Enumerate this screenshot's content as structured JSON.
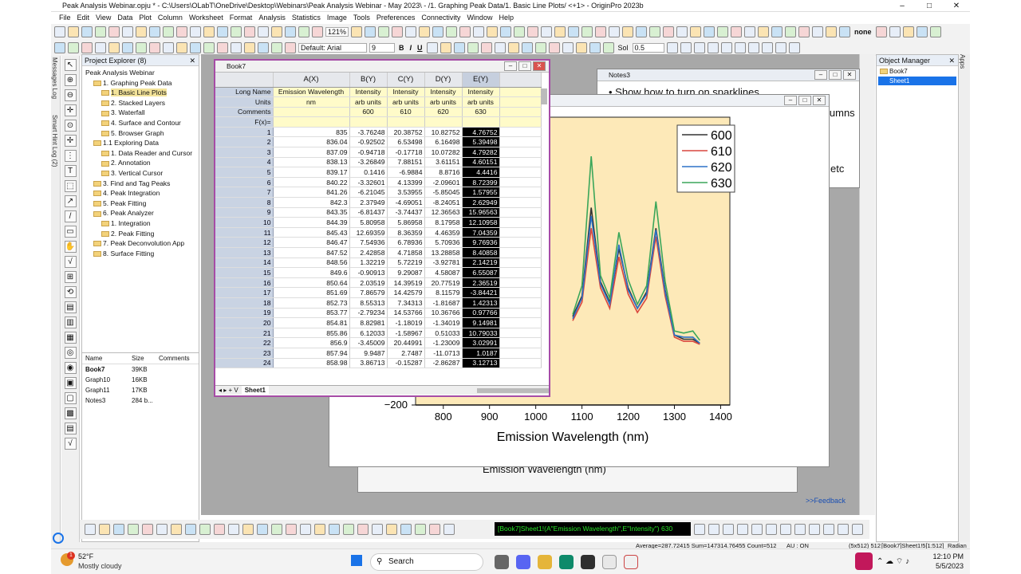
{
  "window": {
    "title": "Peak Analysis Webinar.opju * - C:\\Users\\OLabT\\OneDrive\\Desktop\\Webinars\\Peak Analysis Webinar - May 2023\\ - /1. Graphing Peak Data/1. Basic Line Plots/ <+1> - OriginPro 2023b",
    "min": "–",
    "max": "□",
    "close": "✕"
  },
  "menu": [
    "File",
    "Edit",
    "View",
    "Data",
    "Plot",
    "Column",
    "Worksheet",
    "Format",
    "Analysis",
    "Statistics",
    "Image",
    "Tools",
    "Preferences",
    "Connectivity",
    "Window",
    "Help"
  ],
  "toolbar": {
    "zoom": "121%",
    "font": "Default: Arial",
    "font_size": "9",
    "bold": "B",
    "italic": "I",
    "underline": "U",
    "line_style": "Sol",
    "line_width": "0.5",
    "none": "none"
  },
  "side_tabs": {
    "messages": "Messages Log",
    "smart_hint": "Smart Hint Log (2)"
  },
  "project_explorer": {
    "title": "Project Explorer (8)",
    "tree": [
      {
        "label": "Peak Analysis Webinar",
        "level": 0
      },
      {
        "label": "1. Graphing Peak Data",
        "level": 1
      },
      {
        "label": "1. Basic Line Plots",
        "level": 2,
        "selected": true
      },
      {
        "label": "2. Stacked Layers",
        "level": 2
      },
      {
        "label": "3. Waterfall",
        "level": 2
      },
      {
        "label": "4. Surface and Contour",
        "level": 2
      },
      {
        "label": "5. Browser Graph",
        "level": 2
      },
      {
        "label": "1.1 Exploring Data",
        "level": 1
      },
      {
        "label": "1. Data Reader and Cursor",
        "level": 2
      },
      {
        "label": "2. Annotation",
        "level": 2
      },
      {
        "label": "3. Vertical Cursor",
        "level": 2
      },
      {
        "label": "3. Find and Tag Peaks",
        "level": 1
      },
      {
        "label": "4. Peak Integration",
        "level": 1
      },
      {
        "label": "5. Peak Fitting",
        "level": 1
      },
      {
        "label": "6. Peak Analyzer",
        "level": 1
      },
      {
        "label": "1. Integration",
        "level": 2
      },
      {
        "label": "2. Peak Fitting",
        "level": 2
      },
      {
        "label": "7. Peak Deconvolution App",
        "level": 1
      },
      {
        "label": "8. Surface Fitting",
        "level": 1
      }
    ],
    "files_headers": [
      "Name",
      "Size",
      "Comments"
    ],
    "files": [
      {
        "name": "Book7",
        "size": "39KB"
      },
      {
        "name": "Graph10",
        "size": "16KB"
      },
      {
        "name": "Graph11",
        "size": "17KB"
      },
      {
        "name": "Notes3",
        "size": "284 b..."
      }
    ]
  },
  "object_manager": {
    "title": "Object Manager",
    "items": [
      "Book7",
      "Sheet1"
    ],
    "apps": "Apps"
  },
  "notes": {
    "title": "Notes3",
    "line1": "Show how to turn on sparklines",
    "frag1": "lumns",
    "frag2": "etc"
  },
  "graph": {
    "back_title": "Emission Wavelength (nm)",
    "xlabel": "Emission Wavelength (nm)",
    "ytick": "−200",
    "xticks": [
      "800",
      "900",
      "1000",
      "1100",
      "1200",
      "1300",
      "1400"
    ],
    "legend": [
      "600",
      "610",
      "620",
      "630"
    ]
  },
  "chart_data": {
    "type": "line",
    "xlabel": "Emission Wavelength (nm)",
    "xlim": [
      740,
      1420
    ],
    "ylim": [
      -200,
      1200
    ],
    "series": [
      {
        "name": "600",
        "color": "#333333",
        "values": [
          [
            1080,
            230
          ],
          [
            1100,
            330
          ],
          [
            1120,
            760
          ],
          [
            1140,
            400
          ],
          [
            1160,
            300
          ],
          [
            1180,
            560
          ],
          [
            1200,
            370
          ],
          [
            1220,
            270
          ],
          [
            1240,
            350
          ],
          [
            1260,
            660
          ],
          [
            1280,
            360
          ],
          [
            1300,
            140
          ],
          [
            1320,
            120
          ],
          [
            1340,
            120
          ],
          [
            1355,
            100
          ]
        ]
      },
      {
        "name": "610",
        "color": "#d9463e",
        "values": [
          [
            1080,
            210
          ],
          [
            1100,
            300
          ],
          [
            1120,
            660
          ],
          [
            1140,
            370
          ],
          [
            1160,
            270
          ],
          [
            1180,
            520
          ],
          [
            1200,
            340
          ],
          [
            1220,
            250
          ],
          [
            1240,
            320
          ],
          [
            1260,
            620
          ],
          [
            1280,
            330
          ],
          [
            1300,
            130
          ],
          [
            1320,
            110
          ],
          [
            1340,
            110
          ],
          [
            1355,
            95
          ]
        ]
      },
      {
        "name": "620",
        "color": "#2d72c8",
        "values": [
          [
            1080,
            220
          ],
          [
            1100,
            320
          ],
          [
            1120,
            720
          ],
          [
            1140,
            390
          ],
          [
            1160,
            290
          ],
          [
            1180,
            580
          ],
          [
            1200,
            360
          ],
          [
            1220,
            270
          ],
          [
            1240,
            340
          ],
          [
            1260,
            650
          ],
          [
            1280,
            350
          ],
          [
            1300,
            140
          ],
          [
            1320,
            130
          ],
          [
            1340,
            130
          ],
          [
            1355,
            100
          ]
        ]
      },
      {
        "name": "630",
        "color": "#3aa65a",
        "values": [
          [
            1080,
            240
          ],
          [
            1100,
            380
          ],
          [
            1120,
            1010
          ],
          [
            1140,
            430
          ],
          [
            1160,
            320
          ],
          [
            1180,
            640
          ],
          [
            1200,
            410
          ],
          [
            1220,
            290
          ],
          [
            1240,
            380
          ],
          [
            1260,
            790
          ],
          [
            1280,
            400
          ],
          [
            1300,
            160
          ],
          [
            1320,
            150
          ],
          [
            1340,
            160
          ],
          [
            1355,
            115
          ]
        ]
      }
    ]
  },
  "book": {
    "title": "Book7",
    "col_headers": [
      "A(X)",
      "B(Y)",
      "C(Y)",
      "D(Y)",
      "E(Y)"
    ],
    "row_labels": {
      "long_name": "Long Name",
      "units": "Units",
      "comments": "Comments",
      "fx": "F(x)="
    },
    "long_names": [
      "Emission Wavelength",
      "Intensity",
      "Intensity",
      "Intensity",
      "Intensity"
    ],
    "units": [
      "nm",
      "arb units",
      "arb units",
      "arb units",
      "arb units"
    ],
    "comments": [
      "",
      "600",
      "610",
      "620",
      "630"
    ],
    "rows": [
      [
        "835",
        "-3.76248",
        "20.38752",
        "10.82752",
        "4.76752"
      ],
      [
        "836.04",
        "-0.92502",
        "6.53498",
        "6.16498",
        "5.39498"
      ],
      [
        "837.09",
        "-0.94718",
        "-0.17718",
        "10.07282",
        "4.79282"
      ],
      [
        "838.13",
        "-3.26849",
        "7.88151",
        "3.61151",
        "4.60151"
      ],
      [
        "839.17",
        "0.1416",
        "-6.9884",
        "8.8716",
        "4.4416"
      ],
      [
        "840.22",
        "-3.32601",
        "4.13399",
        "-2.09601",
        "8.72399"
      ],
      [
        "841.26",
        "-6.21045",
        "3.53955",
        "-5.85045",
        "1.57955"
      ],
      [
        "842.3",
        "2.37949",
        "-4.69051",
        "-8.24051",
        "2.62949"
      ],
      [
        "843.35",
        "-6.81437",
        "-3.74437",
        "12.36563",
        "15.96563"
      ],
      [
        "844.39",
        "5.80958",
        "5.86958",
        "8.17958",
        "12.10958"
      ],
      [
        "845.43",
        "12.69359",
        "8.36359",
        "4.46359",
        "7.04359"
      ],
      [
        "846.47",
        "7.54936",
        "6.78936",
        "5.70936",
        "9.76936"
      ],
      [
        "847.52",
        "2.42858",
        "4.71858",
        "13.28858",
        "8.40858"
      ],
      [
        "848.56",
        "1.32219",
        "5.72219",
        "-3.92781",
        "2.14219"
      ],
      [
        "849.6",
        "-0.90913",
        "9.29087",
        "4.58087",
        "6.55087"
      ],
      [
        "850.64",
        "2.03519",
        "14.39519",
        "20.77519",
        "2.36519"
      ],
      [
        "851.69",
        "7.86579",
        "14.42579",
        "8.11579",
        "-3.84421"
      ],
      [
        "852.73",
        "8.55313",
        "7.34313",
        "-1.81687",
        "1.42313"
      ],
      [
        "853.77",
        "-2.79234",
        "14.53766",
        "10.36766",
        "0.97766"
      ],
      [
        "854.81",
        "8.82981",
        "-1.18019",
        "-1.34019",
        "9.14981"
      ],
      [
        "855.86",
        "6.12033",
        "-1.58967",
        "0.51033",
        "10.79033"
      ],
      [
        "856.9",
        "-3.45009",
        "20.44991",
        "-1.23009",
        "3.02991"
      ],
      [
        "857.94",
        "9.9487",
        "2.7487",
        "-11.0713",
        "1.0187"
      ],
      [
        "858.98",
        "3.86713",
        "-0.15287",
        "-2.86287",
        "3.12713"
      ]
    ],
    "sheet": "Sheet1"
  },
  "feedback": ">>Feedback",
  "command": "[Book7]Sheet1!(A\"Emission Wavelength\",E\"Intensity\") 630",
  "status": {
    "stats": "Average=287.72415 Sum=147314.76455 Count=512",
    "au": "AU : ON",
    "size": "(5x512) 512",
    "ref": "[Book7]Sheet1!5[1:512]",
    "unit": "Radian"
  },
  "taskbar": {
    "temp": "52°F",
    "weather": "Mostly cloudy",
    "search": "Search",
    "time": "12:10 PM",
    "date": "5/5/2023",
    "badge": "1"
  }
}
